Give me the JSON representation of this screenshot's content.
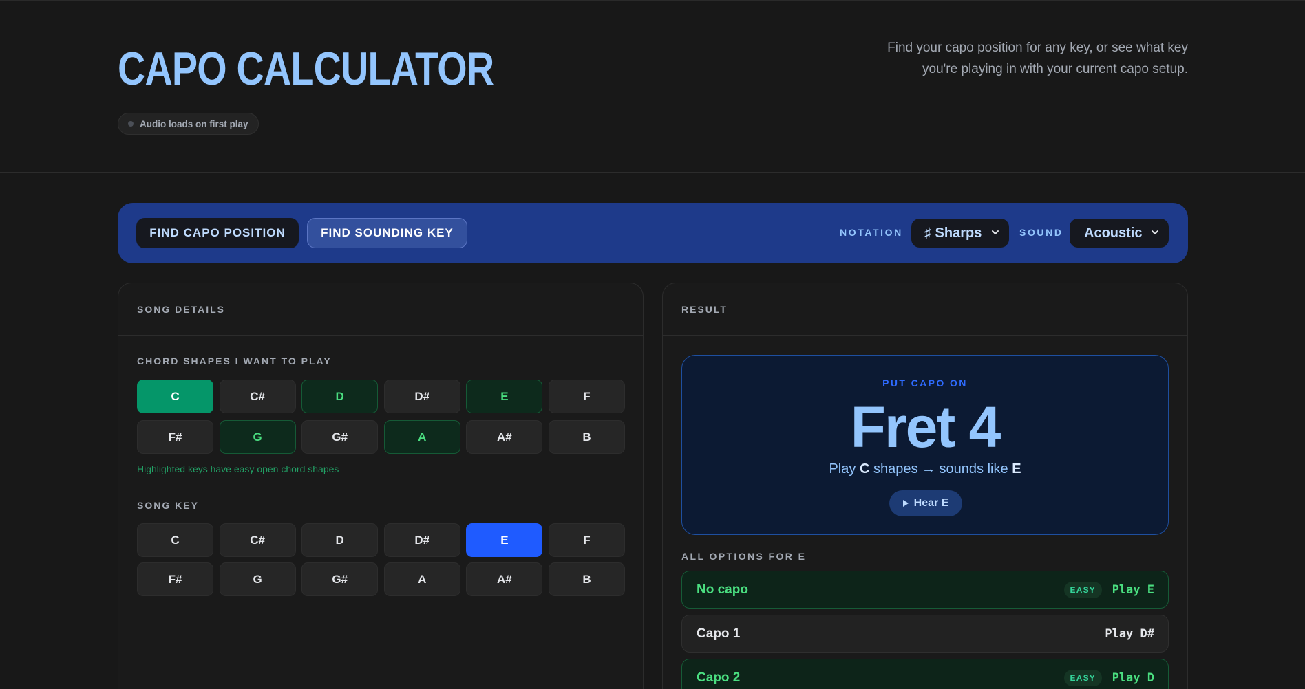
{
  "header": {
    "title": "CAPO CALCULATOR",
    "audio_status": "Audio loads on first play",
    "tagline": "Find your capo position for any key, or see what key you're playing in with your current capo setup."
  },
  "toolbar": {
    "mode_find_capo": "FIND CAPO POSITION",
    "mode_find_key": "FIND SOUNDING KEY",
    "notation_label": "NOTATION",
    "notation_value": "♯ Sharps",
    "sound_label": "SOUND",
    "sound_value": "Acoustic"
  },
  "song_details": {
    "title": "SONG DETAILS",
    "chord_shapes_label": "CHORD SHAPES I WANT TO PLAY",
    "chord_shapes": [
      "C",
      "C#",
      "D",
      "D#",
      "E",
      "F",
      "F#",
      "G",
      "G#",
      "A",
      "A#",
      "B"
    ],
    "hint": "Highlighted keys have easy open chord shapes",
    "song_key_label": "SONG KEY",
    "song_keys": [
      "C",
      "C#",
      "D",
      "D#",
      "E",
      "F",
      "F#",
      "G",
      "G#",
      "A",
      "A#",
      "B"
    ]
  },
  "result": {
    "title": "RESULT",
    "put_capo_label": "PUT CAPO ON",
    "fret": "Fret 4",
    "play_prefix": "Play",
    "play_shape": "C",
    "mid_text": "shapes → sounds like",
    "sounding_key": "E",
    "hear_button": "Hear E",
    "options_label": "ALL OPTIONS FOR E",
    "options": [
      {
        "name": "No capo",
        "badge": "EASY",
        "play": "Play E"
      },
      {
        "name": "Capo 1",
        "badge": "",
        "play": "Play D#"
      },
      {
        "name": "Capo 2",
        "badge": "EASY",
        "play": "Play D"
      }
    ]
  },
  "colors": {
    "accent": "#93c5fd",
    "toolbar_bg": "#1e3a8a",
    "easy_green": "#4ade80",
    "selected_green": "#059669",
    "selected_blue": "#1f5bff"
  }
}
